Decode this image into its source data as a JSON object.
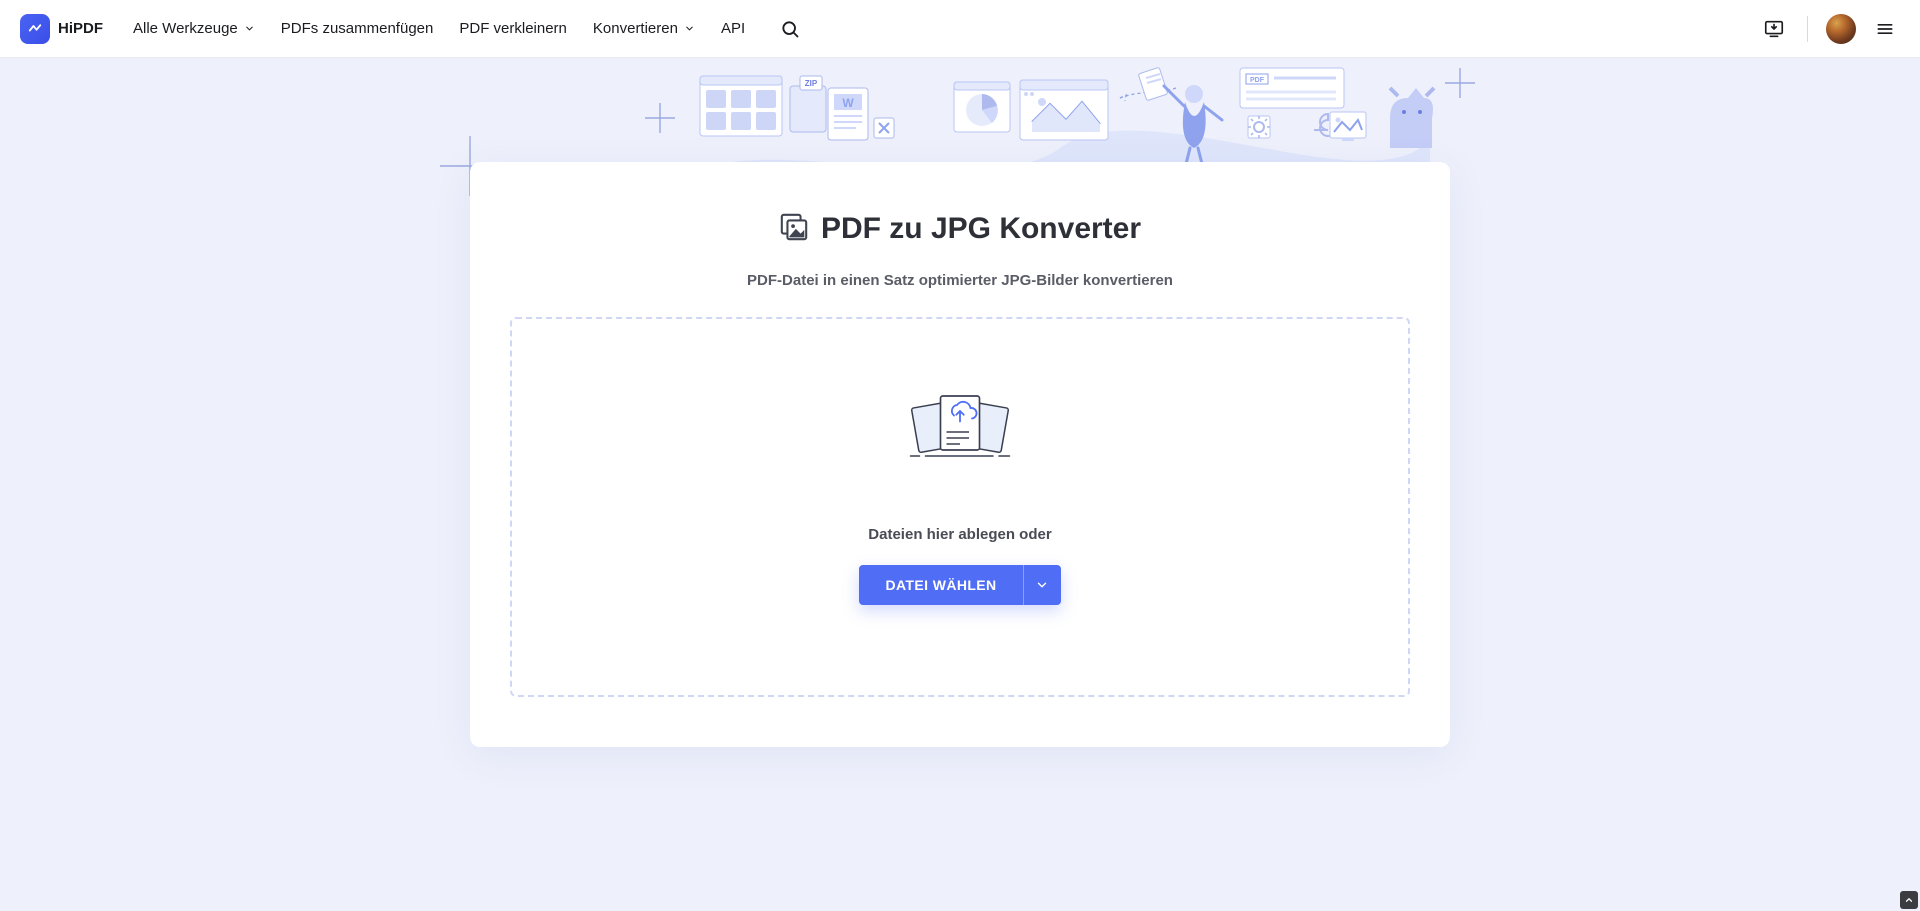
{
  "brand": {
    "name": "HiPDF"
  },
  "nav": {
    "all_tools": "Alle Werkzeuge",
    "merge_pdf": "PDFs zusammenfügen",
    "compress_pdf": "PDF verkleinern",
    "convert": "Konvertieren",
    "api": "API"
  },
  "page": {
    "title": "PDF zu JPG Konverter",
    "subtitle": "PDF-Datei in einen Satz optimierter JPG-Bilder konvertieren"
  },
  "drop": {
    "hint": "Dateien hier ablegen oder",
    "button": "DATEI WÄHLEN"
  }
}
